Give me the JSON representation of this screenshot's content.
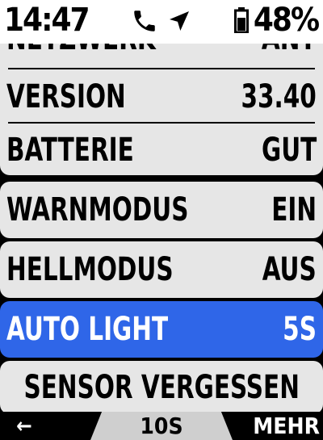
{
  "status": {
    "time": "14:47",
    "icons": [
      "phone-icon",
      "navigation-arrow-icon",
      "battery-icon"
    ],
    "battery_percent": "48%"
  },
  "settings": {
    "partial_row": {
      "label": "NETZWERK",
      "value": "ANT"
    },
    "version": {
      "label": "VERSION",
      "value": "33.40"
    },
    "battery": {
      "label": "BATTERIE",
      "value": "GUT"
    },
    "warn_mode": {
      "label": "WARNMODUS",
      "value": "EIN"
    },
    "bright_mode": {
      "label": "HELLMODUS",
      "value": "AUS"
    },
    "auto_light": {
      "label": "AUTO LIGHT",
      "value": "5S"
    },
    "forget_sensor": {
      "label": "SENSOR VERGESSEN"
    }
  },
  "footer": {
    "back": "←",
    "middle": "10S",
    "more": "MEHR"
  },
  "colors": {
    "selected": "#2f66e8",
    "row_bg": "#e6e6e6"
  }
}
